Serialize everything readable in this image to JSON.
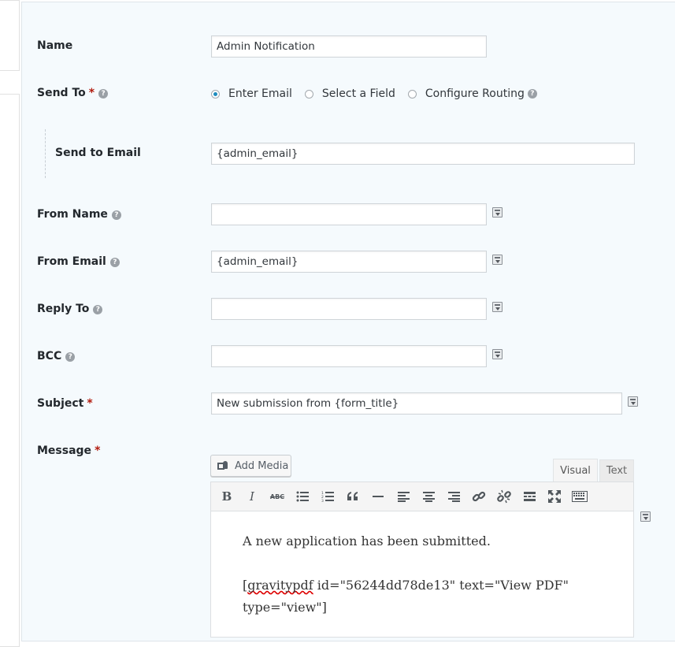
{
  "form": {
    "name": {
      "label": "Name",
      "value": "Admin Notification"
    },
    "send_to": {
      "label": "Send To",
      "required_mark": "*",
      "options": [
        "Enter Email",
        "Select a Field",
        "Configure Routing"
      ],
      "selected": "Enter Email"
    },
    "send_to_email": {
      "label": "Send to Email",
      "value": "{admin_email}"
    },
    "from_name": {
      "label": "From Name",
      "value": ""
    },
    "from_email": {
      "label": "From Email",
      "value": "{admin_email}"
    },
    "reply_to": {
      "label": "Reply To",
      "value": ""
    },
    "bcc": {
      "label": "BCC",
      "value": ""
    },
    "subject": {
      "label": "Subject",
      "required_mark": "*",
      "value": "New submission from {form_title}"
    },
    "message": {
      "label": "Message",
      "required_mark": "*",
      "add_media_label": "Add Media",
      "tabs": [
        "Visual",
        "Text"
      ],
      "active_tab": "Visual",
      "toolbar": [
        "bold",
        "italic",
        "strikethrough",
        "bullet-list",
        "numbered-list",
        "blockquote",
        "horizontal-rule",
        "align-left",
        "align-center",
        "align-right",
        "link",
        "unlink",
        "read-more",
        "fullscreen",
        "toolbar-toggle"
      ],
      "body": {
        "para1": "A new application has been submitted.",
        "para2_word": "gravitypdf",
        "para2_prefix": "[",
        "para2_rest": " id=\"56244dd78de13\" text=\"View PDF\" type=\"view\"]"
      }
    }
  },
  "help_glyph": "?",
  "icons": [
    "help-icon",
    "merge-tag-icon",
    "add-media-icon"
  ]
}
